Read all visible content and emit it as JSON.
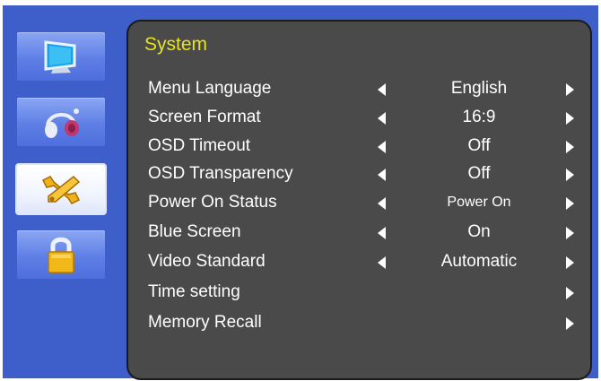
{
  "sidebar": {
    "items": [
      {
        "icon": "monitor-icon",
        "active": false
      },
      {
        "icon": "headphones-icon",
        "active": false
      },
      {
        "icon": "wrench-icon",
        "active": true
      },
      {
        "icon": "lock-icon",
        "active": false
      }
    ]
  },
  "panel": {
    "title": "System",
    "rows": [
      {
        "label": "Menu Language",
        "value": "English"
      },
      {
        "label": "Screen Format",
        "value": "16:9"
      },
      {
        "label": "OSD Timeout",
        "value": "Off"
      },
      {
        "label": "OSD Transparency",
        "value": "Off"
      },
      {
        "label": "Power On Status",
        "value": "Power On"
      },
      {
        "label": "Blue Screen",
        "value": "On"
      },
      {
        "label": "Video Standard",
        "value": "Automatic"
      },
      {
        "label": "Time setting",
        "value": null
      },
      {
        "label": "Memory Recall",
        "value": null
      }
    ]
  },
  "colors": {
    "frame": "#3e5fc9",
    "panel": "#4a4a4a",
    "title": "#e8e31a",
    "text": "#ffffff"
  }
}
